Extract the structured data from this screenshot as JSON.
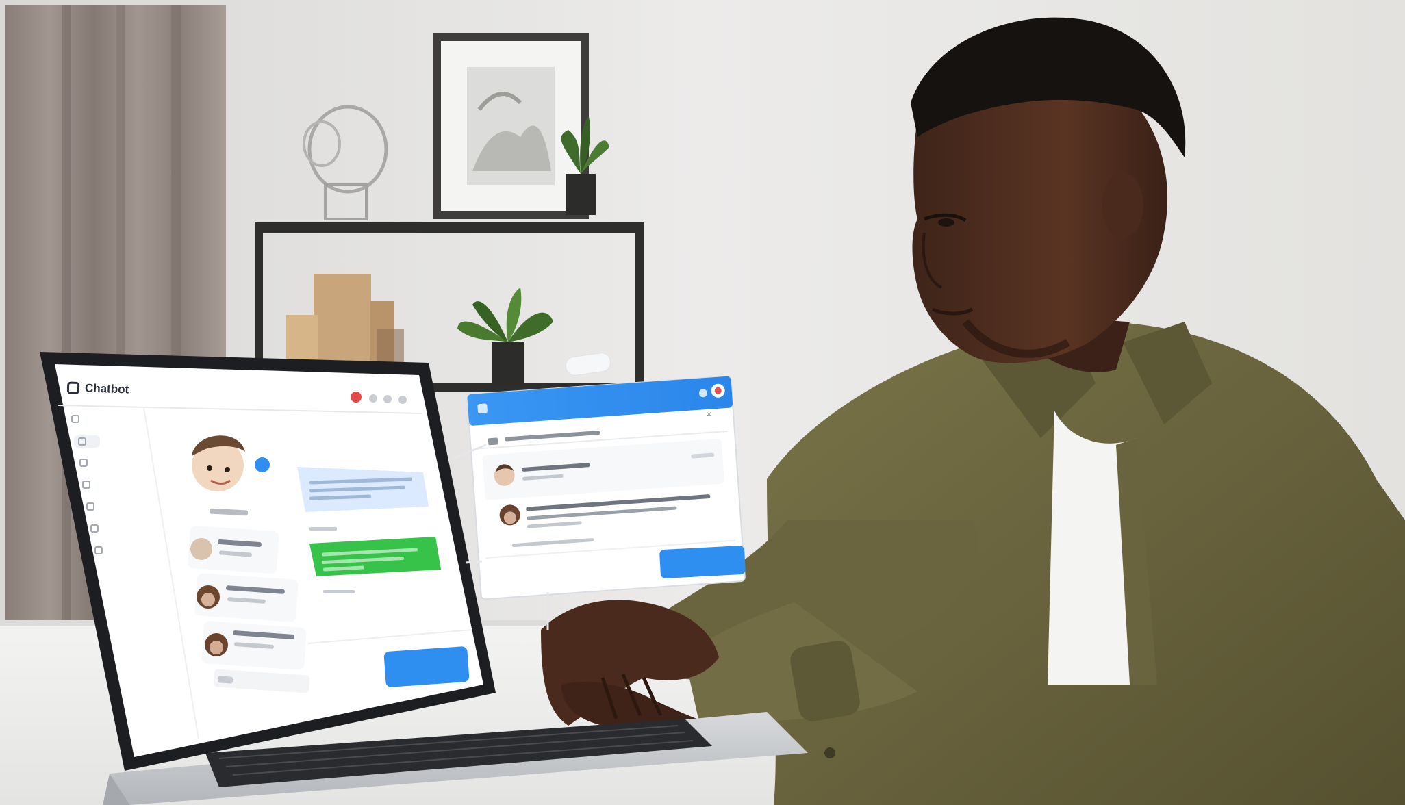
{
  "app": {
    "name": "Chatbot"
  },
  "nav": {
    "items": [
      {
        "label": "",
        "icon": "home-icon"
      },
      {
        "label": "",
        "icon": "chat-icon"
      },
      {
        "label": "",
        "icon": "clock-icon"
      },
      {
        "label": "",
        "icon": "folder-icon"
      },
      {
        "label": "",
        "icon": "users-icon"
      },
      {
        "label": "",
        "icon": "settings-icon"
      },
      {
        "label": "",
        "icon": "info-icon"
      }
    ]
  },
  "colors": {
    "accent": "#2e8ff0",
    "bubble_user": "#dbeafe",
    "bubble_bot": "#37c24a",
    "jacket": "#6f6a43",
    "wall": "#ececea"
  }
}
